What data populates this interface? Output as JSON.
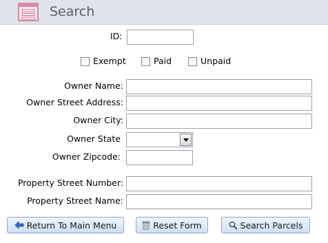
{
  "header": {
    "title": "Search",
    "icon": "form-icon"
  },
  "fields": {
    "id_label": "ID:",
    "owner_name_label": "Owner Name:",
    "owner_street_label": "Owner Street Address:",
    "owner_city_label": "Owner City:",
    "owner_state_label": "Owner State",
    "owner_zip_label": "Owner Zipcode:",
    "prop_number_label": "Property Street Number:",
    "prop_name_label": "Property Street Name:"
  },
  "checkboxes": {
    "exempt": "Exempt",
    "paid": "Paid",
    "unpaid": "Unpaid"
  },
  "buttons": {
    "return": "Return To Main Menu",
    "reset": "Reset Form",
    "search": "Search Parcels"
  },
  "colors": {
    "header_bg": "#dfe3ea",
    "button_border": "#8fa8c8",
    "accent_blue": "#2f6fc0"
  }
}
